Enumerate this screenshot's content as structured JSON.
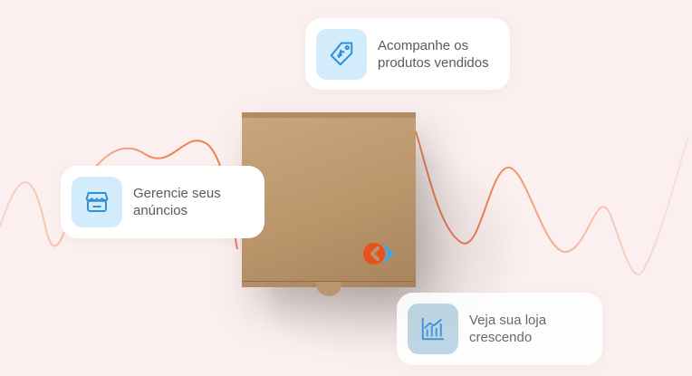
{
  "colors": {
    "background": "#fbf0ef",
    "wave": "#f08a5d",
    "icon_tile": "#d3ecfb",
    "icon_stroke": "#2f8fd8",
    "card_text": "#5a5a5a"
  },
  "cards": [
    {
      "icon": "price-tag-icon",
      "line1": "Acompanhe os",
      "line2": "produtos vendidos"
    },
    {
      "icon": "storefront-icon",
      "line1": "Gerencie seus",
      "line2": "anúncios"
    },
    {
      "icon": "bar-chart-icon",
      "line1": "Veja sua loja",
      "line2": "crescendo"
    }
  ]
}
